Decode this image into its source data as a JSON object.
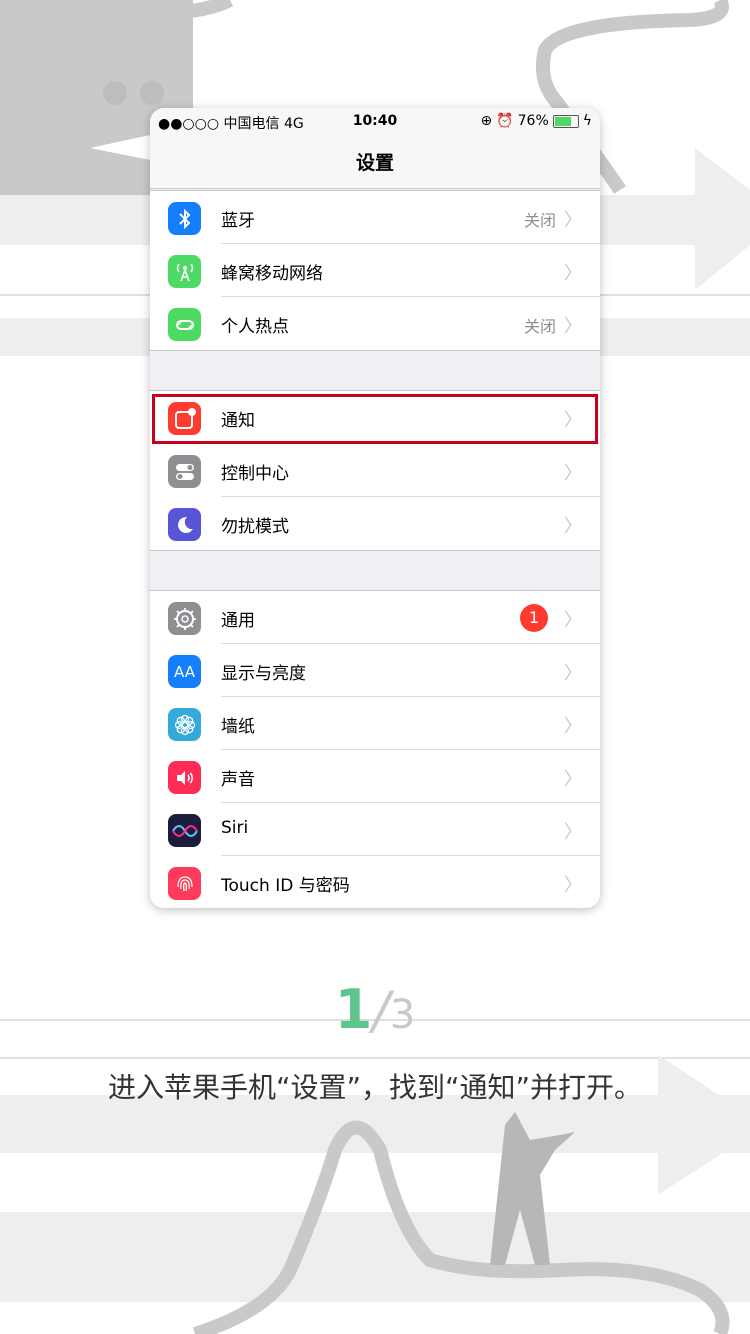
{
  "statusbar": {
    "carrier": "●●○○○ 中国电信  4G",
    "time": "10:40",
    "battery": "76%",
    "battery_level": 0.76
  },
  "nav": {
    "title": "设置"
  },
  "groups": [
    {
      "items": [
        {
          "label": "蓝牙",
          "value": "关闭",
          "icon": "bluetooth-icon",
          "color": "#157efb"
        },
        {
          "label": "蜂窝移动网络",
          "value": "",
          "icon": "cellular-icon",
          "color": "#4cd964"
        },
        {
          "label": "个人热点",
          "value": "关闭",
          "icon": "hotspot-icon",
          "color": "#4cd964"
        }
      ]
    },
    {
      "items": [
        {
          "label": "通知",
          "icon": "notifications-icon",
          "color": "#ff3b30",
          "highlighted": true
        },
        {
          "label": "控制中心",
          "icon": "control-center-icon",
          "color": "#8e8e93"
        },
        {
          "label": "勿扰模式",
          "icon": "moon-icon",
          "color": "#5856d6"
        }
      ]
    },
    {
      "items": [
        {
          "label": "通用",
          "badge": "1",
          "icon": "gear-icon",
          "color": "#8e8e93"
        },
        {
          "label": "显示与亮度",
          "icon": "display-icon",
          "color": "#157efb",
          "icon_text": "AA"
        },
        {
          "label": "墙纸",
          "icon": "wallpaper-icon",
          "color": "#34aadc"
        },
        {
          "label": "声音",
          "icon": "sound-icon",
          "color": "#ff2d55"
        },
        {
          "label": "Siri",
          "icon": "siri-icon",
          "color": "#1c1c3c"
        },
        {
          "label": "Touch ID 与密码",
          "icon": "fingerprint-icon",
          "color": "#ff3b5c"
        }
      ]
    }
  ],
  "pager": {
    "current": "1",
    "separator": "/",
    "total": "3"
  },
  "caption": "进入苹果手机“设置”，找到“通知”并打开。"
}
